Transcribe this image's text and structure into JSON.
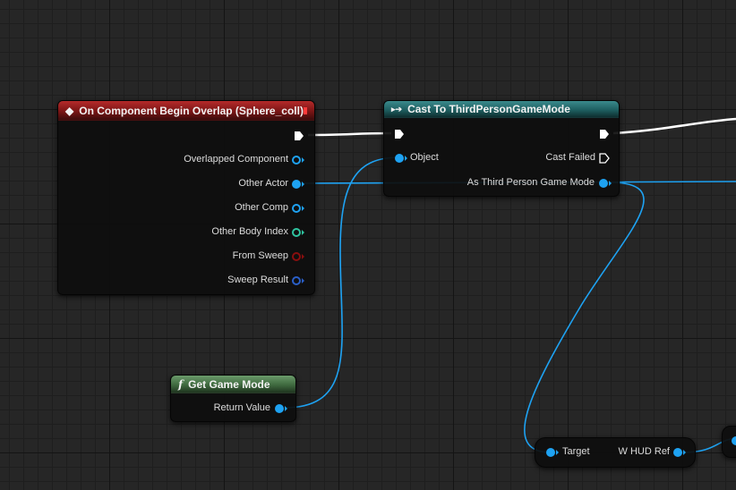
{
  "nodes": {
    "event": {
      "title": "On Component Begin Overlap (Sphere_coll)",
      "pins": [
        "Overlapped Component",
        "Other Actor",
        "Other Comp",
        "Other Body Index",
        "From Sweep",
        "Sweep Result"
      ]
    },
    "cast": {
      "title": "Cast To ThirdPersonGameMode",
      "object_label": "Object",
      "cast_failed_label": "Cast Failed",
      "as_label": "As Third Person Game Mode"
    },
    "get_game_mode": {
      "title": "Get Game Mode",
      "return_label": "Return Value"
    },
    "whud": {
      "target_label": "Target",
      "output_label": "W HUD Ref"
    }
  },
  "colors": {
    "object_pin": "#1ea2f2",
    "exec_wire": "#ffffff",
    "event_header": "#9a1c1c",
    "cast_header": "#2a7476",
    "function_header": "#4c7a4c",
    "int_pin": "#2fc4a0",
    "bool_pin": "#8a0e0e",
    "struct_pin": "#2a5fc8"
  },
  "icons": {
    "event": "event-diamond-icon",
    "cast": "cast-arrow-icon",
    "function": "function-f-icon",
    "close": "close-square-icon"
  }
}
